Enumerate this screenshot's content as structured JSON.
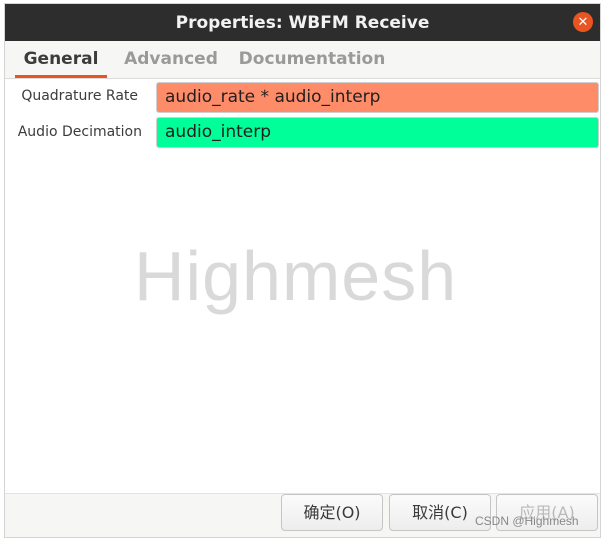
{
  "window": {
    "title": "Properties: WBFM Receive"
  },
  "tabs": [
    {
      "label": "General"
    },
    {
      "label": "Advanced"
    },
    {
      "label": "Documentation"
    }
  ],
  "params": [
    {
      "label": "Quadrature Rate",
      "value": "audio_rate * audio_interp",
      "color": "#ff8c69"
    },
    {
      "label": "Audio Decimation",
      "value": "audio_interp",
      "color": "#00ff99"
    }
  ],
  "watermark": "Highmesh",
  "buttons": {
    "ok": "确定(O)",
    "cancel": "取消(C)",
    "apply": "应用(A)"
  },
  "credit": "CSDN @Highmesh",
  "colors": {
    "accent": "#e95420",
    "titlebar": "#2d2d2d"
  }
}
